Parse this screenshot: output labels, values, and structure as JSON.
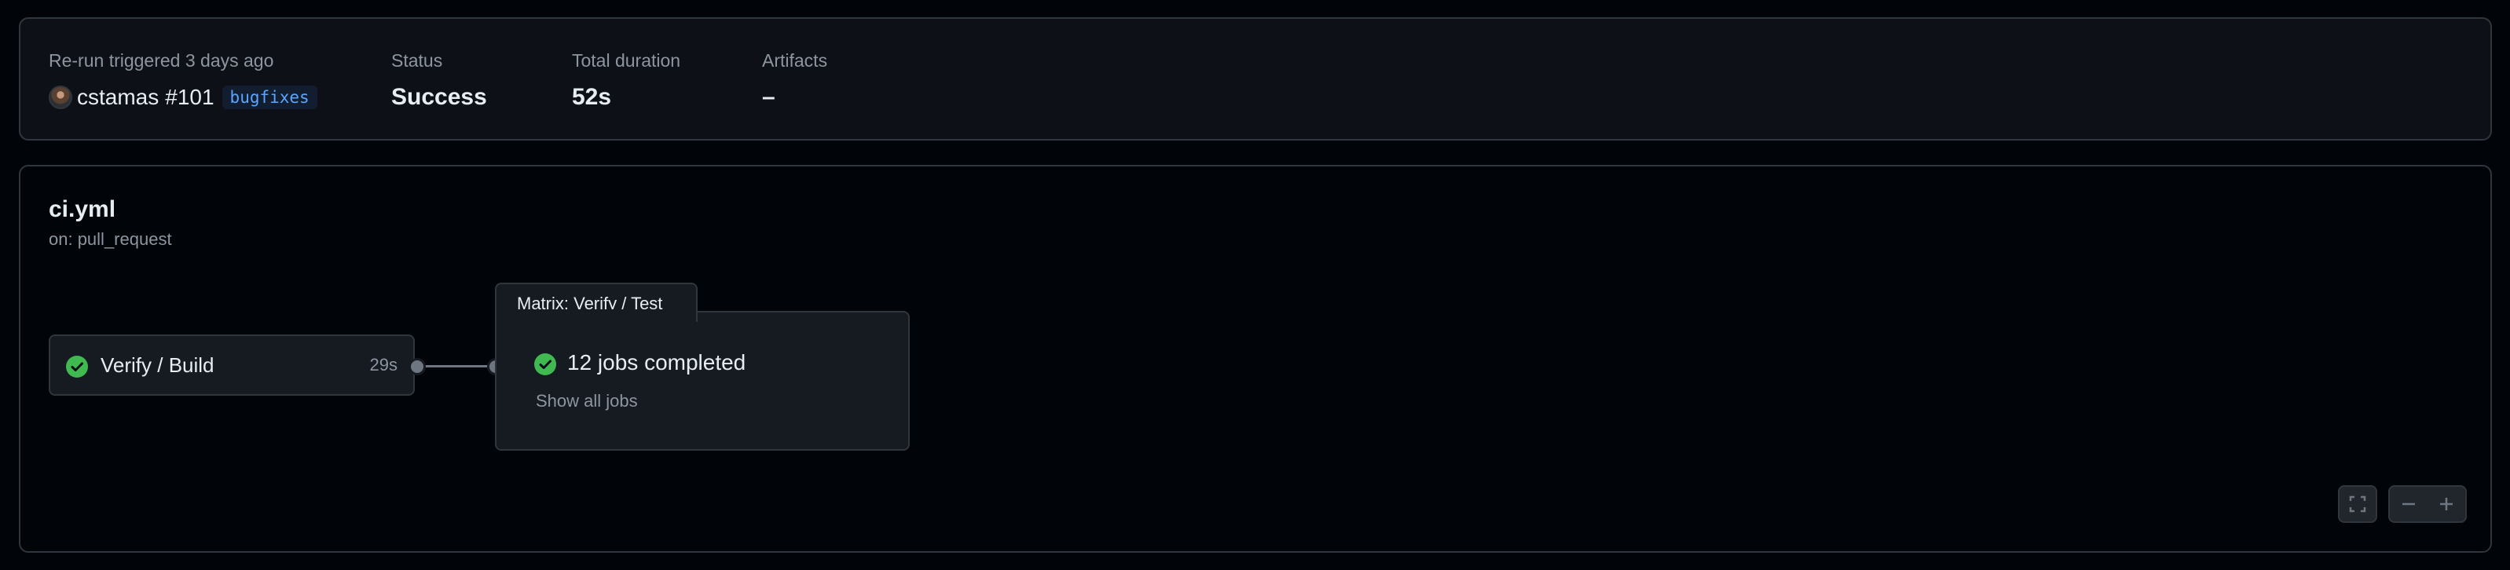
{
  "summary": {
    "trigger_label": "Re-run triggered 3 days ago",
    "actor": "cstamas",
    "run_number": "#101",
    "branch": "bugfixes",
    "status_label": "Status",
    "status_value": "Success",
    "duration_label": "Total duration",
    "duration_value": "52s",
    "artifacts_label": "Artifacts",
    "artifacts_value": "–"
  },
  "workflow": {
    "file_name": "ci.yml",
    "trigger": "on: pull_request"
  },
  "jobs": [
    {
      "name": "Verify / Build",
      "duration": "29s",
      "status": "success",
      "status_icon": "check-circle-icon"
    }
  ],
  "matrix": {
    "title": "Matrix: Verify / Test",
    "summary": "12 jobs completed",
    "link_label": "Show all jobs",
    "status_icon": "check-circle-icon"
  },
  "controls": {
    "fullscreen_icon": "fullscreen-icon",
    "zoom_out_icon": "zoom-out-icon",
    "zoom_in_icon": "zoom-in-icon"
  },
  "colors": {
    "page_bg": "#010409",
    "panel_bg": "#0d1117",
    "card_bg": "#161b22",
    "border": "#30363d",
    "success": "#3fb950",
    "link_blue": "#58a6ff",
    "muted_text": "#8d96a0"
  }
}
